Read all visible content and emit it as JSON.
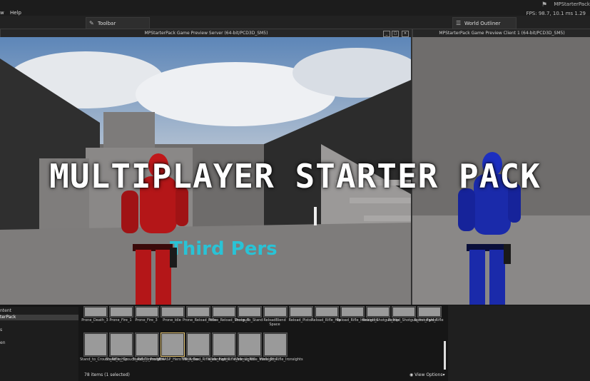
{
  "menu": {
    "items": [
      "w",
      "Help"
    ]
  },
  "tabs": {
    "toolbar": "Toolbar",
    "outliner": "World Outliner"
  },
  "header": {
    "app_title": "MPStarterPack",
    "fps_label": "FPS: 98.7",
    "ms_label": "10.1 ms",
    "ms2_label": "1.29"
  },
  "window_server": {
    "title": "MPStarterPack Game Preview Server (64-bit/PCD3D_SM5)"
  },
  "window_client": {
    "title": "MPStarterPack Game Preview Client 1 (64-bit/PCD3D_SM5)"
  },
  "headline": "MULTIPLAYER STARTER PACK",
  "floor_text": "Third Pers",
  "tree": {
    "items": [
      "ntent",
      "terPack",
      "s",
      "en"
    ]
  },
  "assets_row1": [
    "Prone_Death_3",
    "Prone_Fire_1",
    "Prone_Fire_3",
    "Prone_Idle",
    "Prone_Reload_Rifle",
    "Prone_Reload_Shotgun",
    "Prone_To_Stand",
    "ReloadBlend Space",
    "Reload_Pistol",
    "Reload_Rifle_Hip",
    "Reload_Rifle_Ironsights",
    "Reload_Shotgun_Hip",
    "Reload_Shotgun_Ironsights",
    "Sprint_Fwd_Rifle"
  ],
  "assets_row2": [
    "Stand_to_Crouch_Rifle_Hip",
    "Stand_to_Crouch_Rifle_Ironsights",
    "Stand_To_Prone",
    "UE4ASP_HeroTPP_Anim...",
    "Walk_Bwd_Rifle_Ironsights",
    "Walk_Fwd_Rifle_Ironsights",
    "Walk_Lt_Rifle_Ironsights",
    "Walk_Rt_Rifle_Ironsights"
  ],
  "status": "78 items (1 selected)",
  "view_options": "View Options▾",
  "colors": {
    "red_char": "#c0181a",
    "blue_char": "#1d2fbf",
    "floor_text": "#29c3d6",
    "sky": "#5d86b8"
  }
}
